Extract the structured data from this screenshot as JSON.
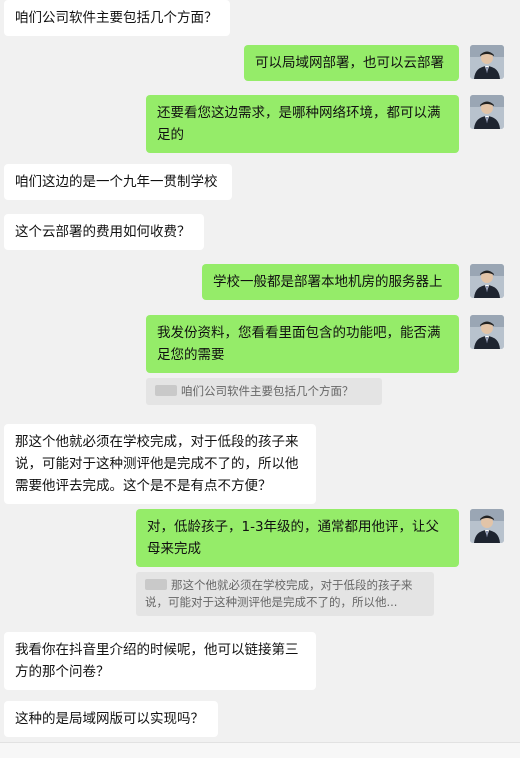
{
  "messages": [
    {
      "side": "in",
      "text": "咱们公司软件主要包括几个方面？"
    },
    {
      "side": "out",
      "text": "可以局域网部署，也可以云部署"
    },
    {
      "side": "out",
      "text": "还要看您这边需求，是哪种网络环境，都可以满足的"
    },
    {
      "side": "in",
      "text": "咱们这边的是一个九年一贯制学校"
    },
    {
      "side": "in",
      "text": "这个云部署的费用如何收费？"
    },
    {
      "side": "out",
      "text": "学校一般都是部署本地机房的服务器上"
    },
    {
      "side": "out",
      "text": "我发份资料，您看看里面包含的功能吧，能否满足您的需要"
    },
    {
      "side": "quote",
      "text": "咱们公司软件主要包括几个方面？"
    },
    {
      "side": "in",
      "text": "那这个他就必须在学校完成，对于低段的孩子来说，可能对于这种测评他是完成不了的，所以他需要他评去完成。这个是不是有点不方便？"
    },
    {
      "side": "out",
      "text": "对，低龄孩子，1-3年级的，通常都用他评，让父母来完成"
    },
    {
      "side": "quote",
      "text": "那这个他就必须在学校完成，对于低段的孩子来说，可能对于这种测评他是完成不了的，所以他..."
    },
    {
      "side": "in",
      "text": "我看你在抖音里介绍的时候呢，他可以链接第三方的那个问卷？"
    },
    {
      "side": "in",
      "text": "这种的是局域网版可以实现吗？"
    }
  ],
  "icons": {
    "avatar": "user-avatar-photo"
  },
  "colors": {
    "background": "#f1f1f1",
    "incoming": "#ffffff",
    "outgoing": "#95ec69",
    "quote": "#e4e4e4"
  }
}
